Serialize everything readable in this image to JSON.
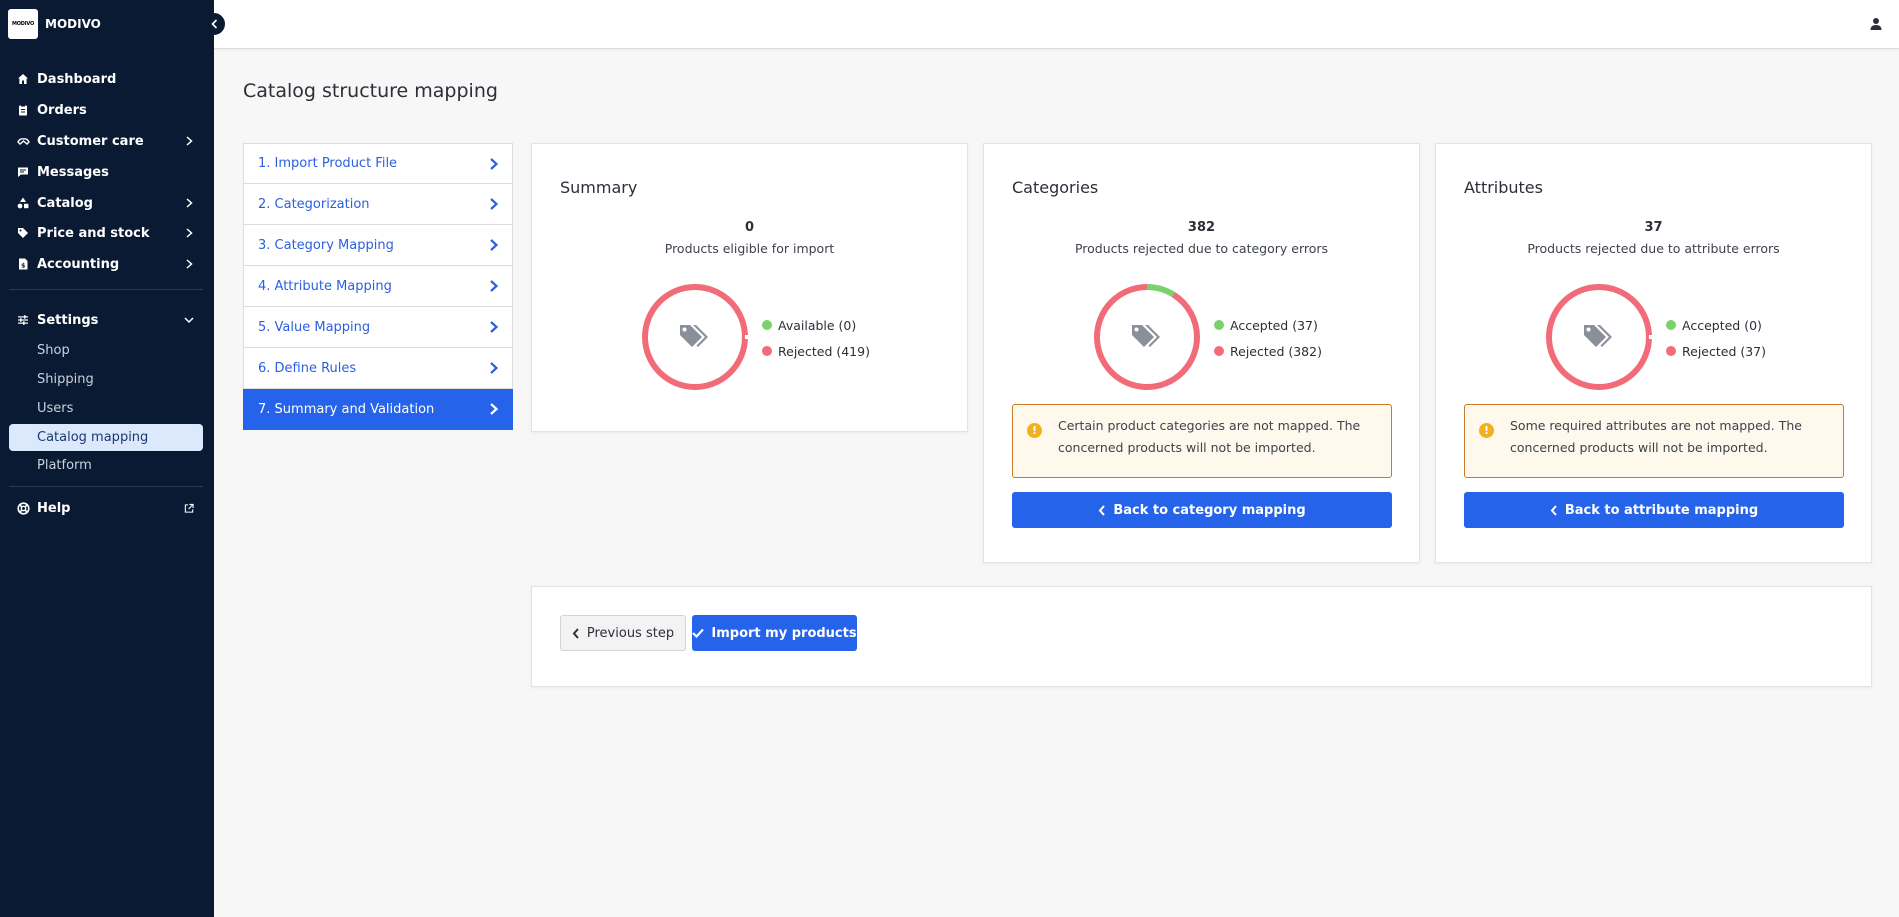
{
  "brand": {
    "logo_text": "MODIVO",
    "name": "MODIVO"
  },
  "nav": {
    "dashboard": "Dashboard",
    "orders": "Orders",
    "customer_care": "Customer care",
    "messages": "Messages",
    "catalog": "Catalog",
    "price_stock": "Price and stock",
    "accounting": "Accounting",
    "settings": "Settings",
    "settings_items": [
      "Shop",
      "Shipping",
      "Users",
      "Catalog mapping",
      "Platform"
    ],
    "help": "Help"
  },
  "page": {
    "title": "Catalog structure mapping"
  },
  "steps": [
    "1. Import Product File",
    "2. Categorization",
    "3. Category Mapping",
    "4. Attribute Mapping",
    "5. Value Mapping",
    "6. Define Rules",
    "7. Summary and Validation"
  ],
  "active_step": 6,
  "colors": {
    "accepted": "#7bd16b",
    "rejected": "#f26b78",
    "primary": "#2563eb",
    "sidebar": "#0b1a33"
  },
  "summary": {
    "title": "Summary",
    "count": "0",
    "label": "Products eligible for import",
    "legend_good": "Available (0)",
    "legend_bad": "Rejected (419)",
    "good_value": 0,
    "bad_value": 419
  },
  "categories": {
    "title": "Categories",
    "count": "382",
    "label": "Products rejected due to category errors",
    "legend_good": "Accepted (37)",
    "legend_bad": "Rejected (382)",
    "good_value": 37,
    "bad_value": 382,
    "alert": "Certain product categories are not mapped. The concerned products will not be imported.",
    "button": "Back to category mapping"
  },
  "attributes": {
    "title": "Attributes",
    "count": "37",
    "label": "Products rejected due to attribute errors",
    "legend_good": "Accepted (0)",
    "legend_bad": "Rejected (37)",
    "good_value": 0,
    "bad_value": 37,
    "alert": "Some required attributes are not mapped. The concerned products will not be imported.",
    "button": "Back to attribute mapping"
  },
  "footer": {
    "previous": "Previous step",
    "import": "Import my products"
  }
}
